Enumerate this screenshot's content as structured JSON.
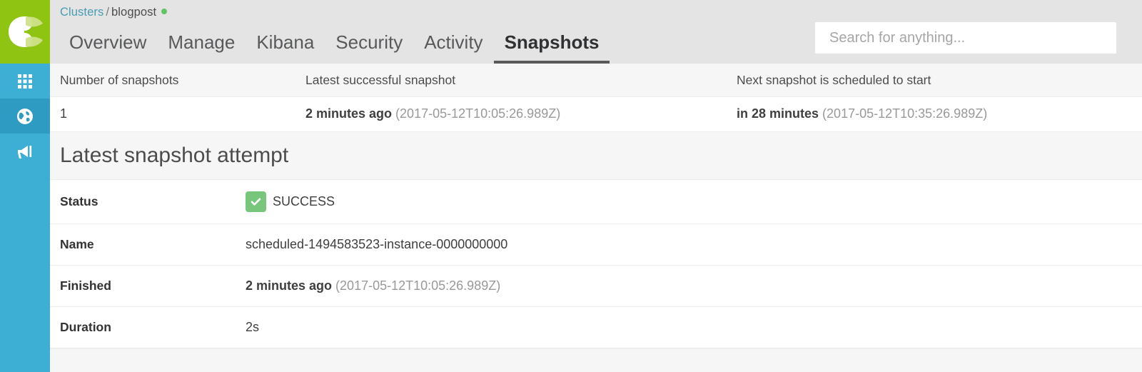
{
  "sidebar": {
    "logo": {
      "icon": "elastic-cloud-logo",
      "color": "#8fc412"
    },
    "items": [
      {
        "icon": "grid-icon",
        "name": "deployments",
        "active": false
      },
      {
        "icon": "globe-icon",
        "name": "regions",
        "active": true
      },
      {
        "icon": "megaphone-icon",
        "name": "announcements",
        "active": false
      }
    ],
    "colors": {
      "base": "#3dafd4",
      "active": "#2d9bc2"
    }
  },
  "header": {
    "breadcrumb": {
      "root": "Clusters",
      "separator": "/",
      "current": "blogpost",
      "status_dot_color": "#62c462"
    },
    "tabs": [
      {
        "label": "Overview",
        "active": false
      },
      {
        "label": "Manage",
        "active": false
      },
      {
        "label": "Kibana",
        "active": false
      },
      {
        "label": "Security",
        "active": false
      },
      {
        "label": "Activity",
        "active": false
      },
      {
        "label": "Snapshots",
        "active": true
      }
    ],
    "search": {
      "placeholder": "Search for anything...",
      "value": ""
    },
    "background": "#e4e4e4"
  },
  "summary": {
    "headers": [
      "Number of snapshots",
      "Latest successful snapshot",
      "Next snapshot is scheduled to start"
    ],
    "row": {
      "count": "1",
      "latest_relative": "2 minutes ago",
      "latest_absolute": "(2017-05-12T10:05:26.989Z)",
      "next_relative": "in 28 minutes",
      "next_absolute": "(2017-05-12T10:35:26.989Z)"
    }
  },
  "latest_attempt": {
    "title": "Latest snapshot attempt",
    "status_label": "Status",
    "status_value": "SUCCESS",
    "status_icon": "check-icon",
    "status_color": "#78c57c",
    "name_label": "Name",
    "name_value": "scheduled-1494583523-instance-0000000000",
    "finished_label": "Finished",
    "finished_relative": "2 minutes ago",
    "finished_absolute": "(2017-05-12T10:05:26.989Z)",
    "duration_label": "Duration",
    "duration_value": "2s"
  }
}
